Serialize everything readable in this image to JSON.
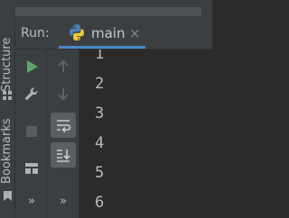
{
  "left_toolwindows": [
    "Structure",
    "Bookmarks"
  ],
  "run_panel": {
    "label": "Run:",
    "tab": {
      "title": "main",
      "close_glyph": "×",
      "icon": "python-icon"
    }
  },
  "toolbar_left": [
    "rerun-icon",
    "wrench-icon",
    "stop-icon",
    "layout-icon",
    "more-icon"
  ],
  "toolbar_right": [
    "up-arrow-icon",
    "down-arrow-icon",
    "soft-wrap-icon",
    "scroll-to-end-icon",
    "more-icon"
  ],
  "more_glyph": "»",
  "console_lines": [
    "1",
    "2",
    "3",
    "4",
    "5",
    "6"
  ],
  "colors": {
    "accent": "#4a88c7",
    "run_green": "#59a869"
  }
}
